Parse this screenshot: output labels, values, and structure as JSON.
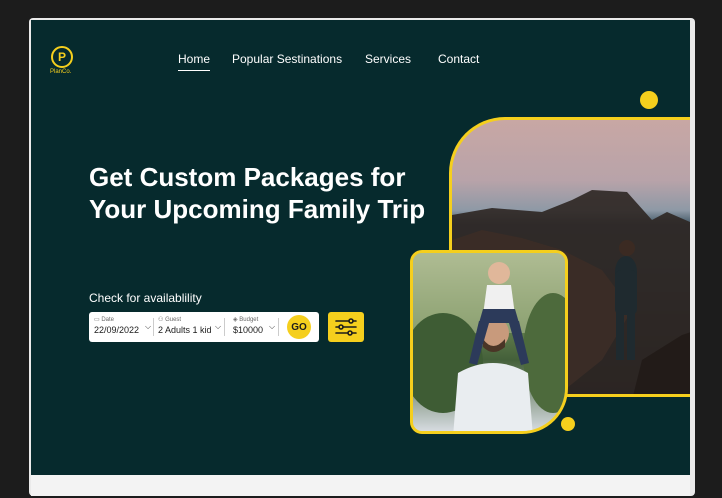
{
  "brand": {
    "logo_letter": "P",
    "name": "PlanCo."
  },
  "nav": [
    {
      "label": "Home",
      "active": true
    },
    {
      "label": "Popular Sestinations",
      "active": false
    },
    {
      "label": "Services",
      "active": false
    },
    {
      "label": "Contact",
      "active": false
    }
  ],
  "hero": {
    "headline_line1": "Get Custom Packages for",
    "headline_line2": "Your Upcoming Family Trip"
  },
  "availability": {
    "label": "Check for availablility",
    "date": {
      "label": "Date",
      "value": "22/09/2022",
      "icon": "calendar-icon"
    },
    "guest": {
      "label": "Guest",
      "value": "2 Adults 1 kid",
      "icon": "people-icon"
    },
    "budget": {
      "label": "Budget",
      "value": "$10000",
      "icon": "tag-icon"
    },
    "go_label": "GO",
    "filter_icon": "sliders-icon"
  },
  "colors": {
    "background": "#062a2d",
    "accent": "#f5cf1d",
    "text": "#ffffff"
  }
}
